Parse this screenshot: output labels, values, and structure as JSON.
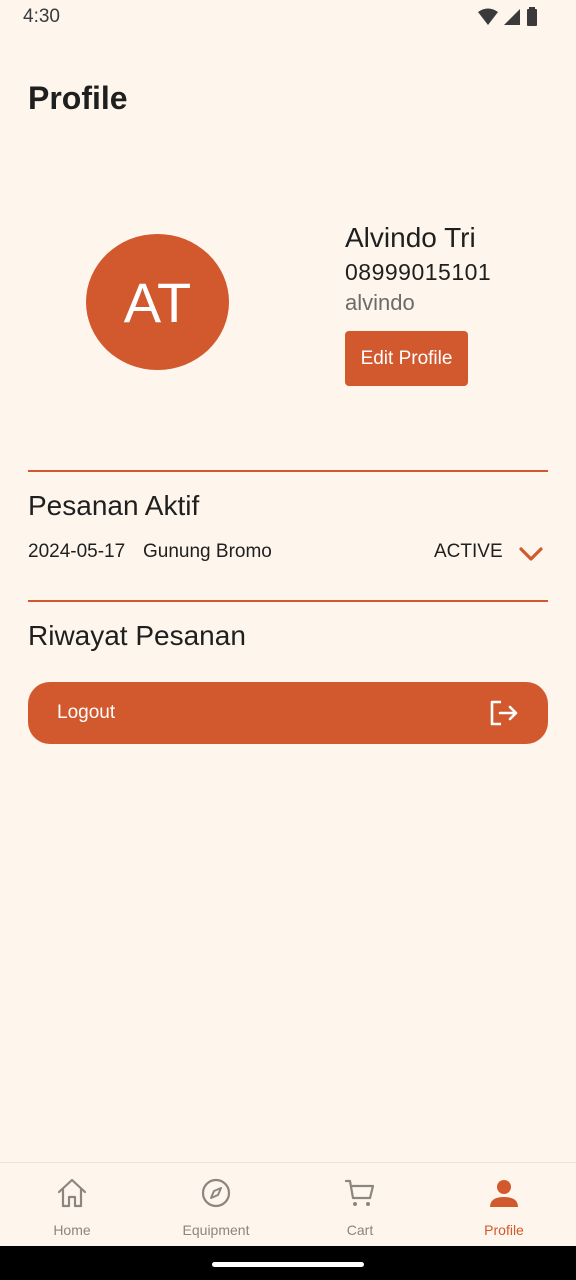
{
  "status_bar": {
    "time": "4:30",
    "icons": [
      "wifi-icon",
      "cellular-signal-icon",
      "battery-icon"
    ]
  },
  "page": {
    "title": "Profile"
  },
  "profile": {
    "initials": "AT",
    "name": "Alvindo Tri",
    "phone": "08999015101",
    "username": "alvindo",
    "edit_label": "Edit Profile"
  },
  "active_orders": {
    "title": "Pesanan Aktif",
    "items": [
      {
        "date": "2024-05-17",
        "location": "Gunung Bromo",
        "status": "ACTIVE"
      }
    ]
  },
  "order_history": {
    "title": "Riwayat Pesanan"
  },
  "logout": {
    "label": "Logout"
  },
  "bottom_nav": {
    "items": [
      {
        "label": "Home",
        "icon": "home-icon",
        "active": false
      },
      {
        "label": "Equipment",
        "icon": "compass-icon",
        "active": false
      },
      {
        "label": "Cart",
        "icon": "cart-icon",
        "active": false
      },
      {
        "label": "Profile",
        "icon": "person-icon",
        "active": true
      }
    ]
  },
  "colors": {
    "accent": "#D2582D",
    "background": "#FEF6EC",
    "nav_inactive": "#8C8580"
  }
}
